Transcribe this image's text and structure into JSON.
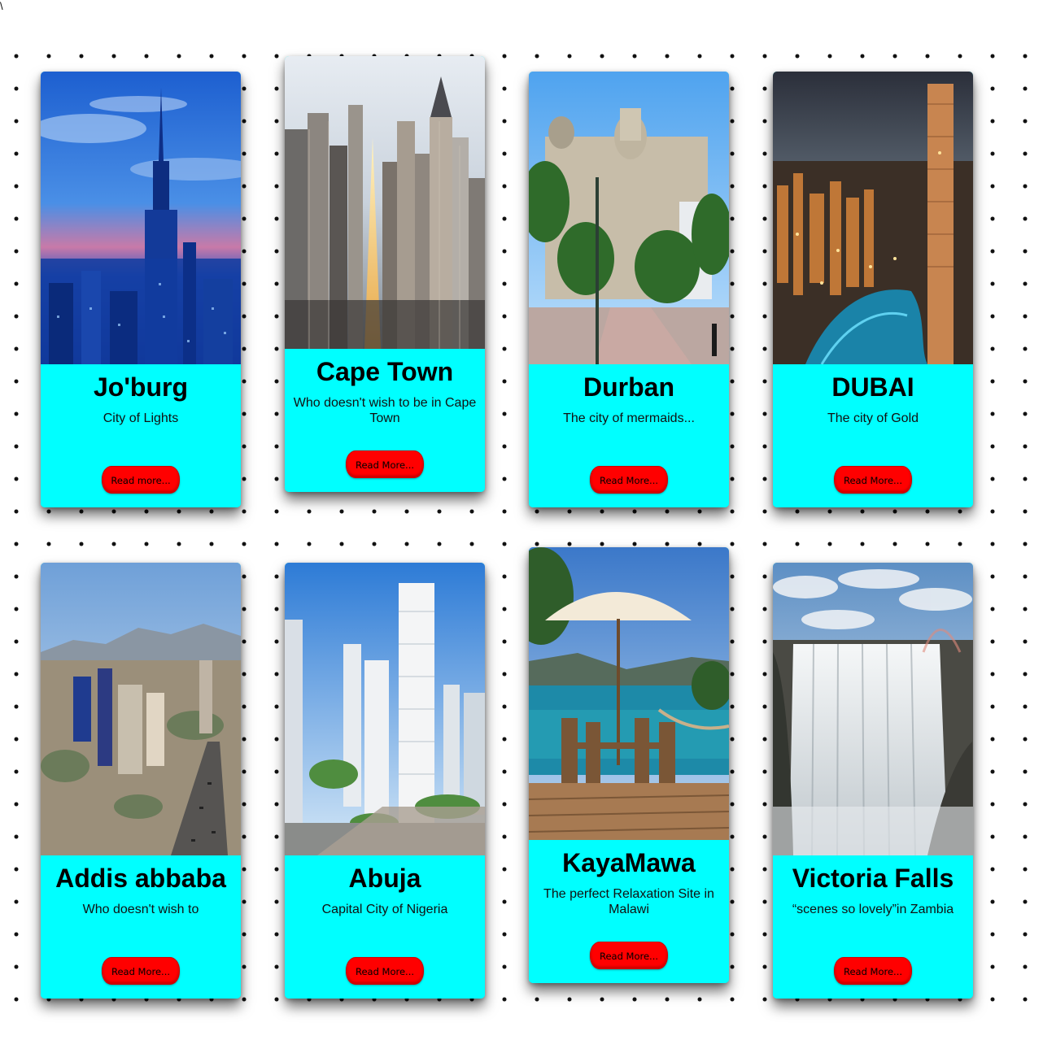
{
  "page": {
    "corner_mark": "\\"
  },
  "colors": {
    "card_body": "#00ffff",
    "button": "#ff0000",
    "dots": "#111111"
  },
  "cards": [
    {
      "title": "Jo'burg",
      "description": "City of Lights",
      "button_label": "Read more...",
      "image": "city-skyline-blue-night-photo"
    },
    {
      "title": "Cape Town",
      "description": "Who doesn't wish to be in Cape Town",
      "button_label": "Read More...",
      "image": "downtown-skyscrapers-street-photo"
    },
    {
      "title": "Durban",
      "description": "The city of mermaids...",
      "button_label": "Read More...",
      "image": "city-hall-palm-trees-photo"
    },
    {
      "title": "DUBAI",
      "description": "The city of Gold",
      "button_label": "Read More...",
      "image": "marina-skyscrapers-night-photo"
    },
    {
      "title": "Addis abbaba",
      "description": "Who doesn't wish to",
      "button_label": "Read More...",
      "image": "city-aerial-mountains-photo"
    },
    {
      "title": "Abuja",
      "description": "Capital City of Nigeria",
      "button_label": "Read More...",
      "image": "modern-towers-rendering-photo"
    },
    {
      "title": "KayaMawa",
      "description": "The perfect Relaxation Site in Malawi",
      "button_label": "Read More...",
      "image": "lakeside-umbrella-deck-photo"
    },
    {
      "title": "Victoria Falls",
      "description": "“scenes so lovely”in Zambia",
      "button_label": "Read More...",
      "image": "waterfall-gorge-photo"
    }
  ]
}
